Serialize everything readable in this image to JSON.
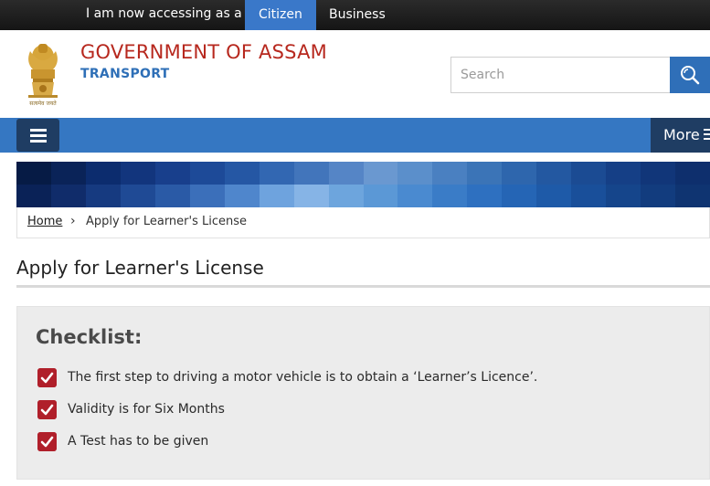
{
  "topbar": {
    "access_label": "I am now accessing as a :",
    "tabs": [
      {
        "label": "Citizen",
        "active": true
      },
      {
        "label": "Business",
        "active": false
      }
    ]
  },
  "header": {
    "emblem_caption": "सत्यमेव जयते",
    "title": "GOVERNMENT OF ASSAM",
    "department": "TRANSPORT"
  },
  "search": {
    "placeholder": "Search",
    "value": "",
    "button_icon": "search-icon"
  },
  "nav": {
    "menu_icon": "hamburger-icon",
    "more_label": "More"
  },
  "breadcrumb": {
    "home": "Home",
    "separator": "›",
    "current": "Apply for Learner's License"
  },
  "page": {
    "title": "Apply for Learner's License"
  },
  "checklist": {
    "heading": "Checklist:",
    "items": [
      "The first step to driving a motor vehicle is to obtain a ‘Learner’s Licence’.",
      "Validity is for Six Months",
      "A Test has to be given"
    ]
  },
  "colors": {
    "topbar": "#1e1e1e",
    "active_tab": "#3a78c9",
    "brand_red": "#b7281e",
    "brand_blue": "#2e6fb7",
    "nav_blue": "#3577c2",
    "nav_dark": "#1f3d63",
    "check_red": "#b01f2a",
    "checklist_bg": "#ececec"
  }
}
